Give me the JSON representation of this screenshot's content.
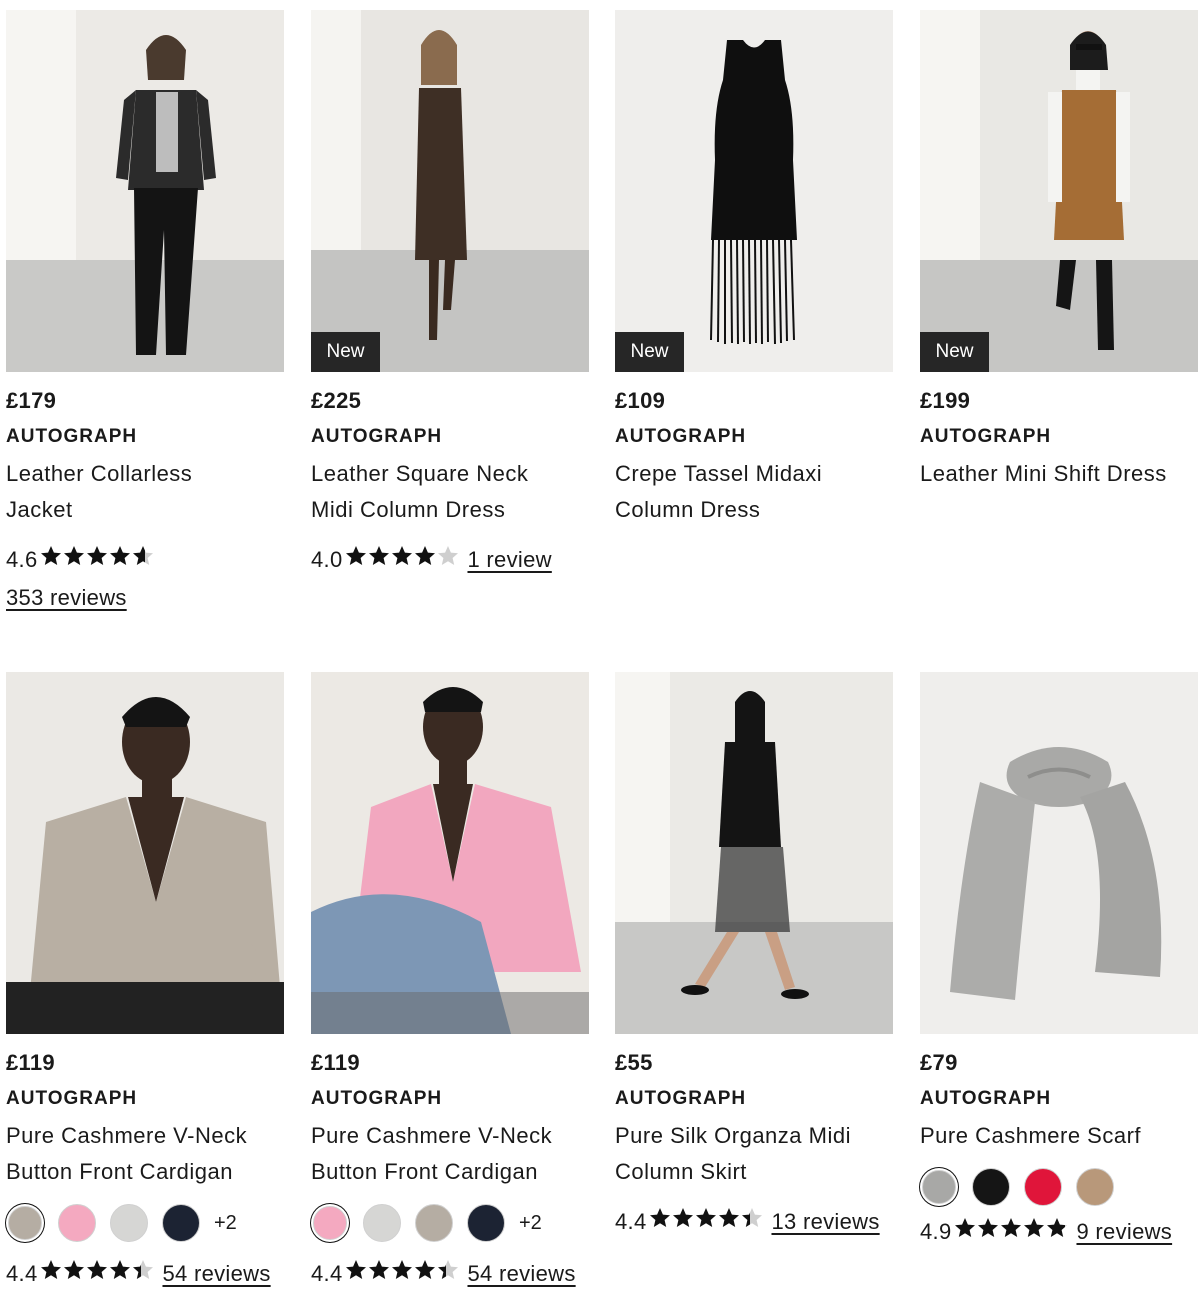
{
  "products": [
    {
      "price": "£179",
      "brand": "AUTOGRAPH",
      "title_line1": "Leather Collarless",
      "title_line2": "Jacket",
      "badge": "",
      "rating": "4.6",
      "stars": 4.6,
      "reviews": "353 reviews",
      "image_icon": "model-leather-jacket-image",
      "swatches": [],
      "more": ""
    },
    {
      "price": "£225",
      "brand": "AUTOGRAPH",
      "title_line1": "Leather Square Neck",
      "title_line2": "Midi Column Dress",
      "badge": "New",
      "rating": "4.0",
      "stars": 4.0,
      "reviews": "1 review",
      "image_icon": "model-leather-dress-image",
      "swatches": [],
      "more": ""
    },
    {
      "price": "£109",
      "brand": "AUTOGRAPH",
      "title_line1": "Crepe Tassel Midaxi",
      "title_line2": "Column Dress",
      "badge": "New",
      "rating": "",
      "stars": 0,
      "reviews": "",
      "image_icon": "tassel-dress-image",
      "swatches": [],
      "more": ""
    },
    {
      "price": "£199",
      "brand": "AUTOGRAPH",
      "title_line1": "Leather Mini Shift Dress",
      "title_line2": "",
      "badge": "New",
      "rating": "",
      "stars": 0,
      "reviews": "",
      "image_icon": "model-shift-dress-image",
      "swatches": [],
      "more": ""
    },
    {
      "price": "£119",
      "brand": "AUTOGRAPH",
      "title_line1": "Pure Cashmere V-Neck",
      "title_line2": "Button Front Cardigan",
      "badge": "",
      "rating": "4.4",
      "stars": 4.4,
      "reviews": "54 reviews",
      "image_icon": "model-oatmeal-cardigan-image",
      "swatches": [
        "#b5ada3",
        "#f4a9c0",
        "#d6d6d4",
        "#1c2333"
      ],
      "more": "+2"
    },
    {
      "price": "£119",
      "brand": "AUTOGRAPH",
      "title_line1": "Pure Cashmere V-Neck",
      "title_line2": "Button Front Cardigan",
      "badge": "",
      "rating": "4.4",
      "stars": 4.4,
      "reviews": "54 reviews",
      "image_icon": "model-pink-cardigan-image",
      "swatches": [
        "#f4a9c0",
        "#d6d6d4",
        "#b5ada3",
        "#1c2333"
      ],
      "more": "+2"
    },
    {
      "price": "£55",
      "brand": "AUTOGRAPH",
      "title_line1": "Pure Silk Organza Midi",
      "title_line2": "Column Skirt",
      "badge": "",
      "rating": "4.4",
      "stars": 4.4,
      "reviews": "13 reviews",
      "image_icon": "model-organza-skirt-image",
      "swatches": [],
      "more": ""
    },
    {
      "price": "£79",
      "brand": "AUTOGRAPH",
      "title_line1": "Pure Cashmere Scarf",
      "title_line2": "",
      "badge": "",
      "rating": "4.9",
      "stars": 4.9,
      "reviews": "9 reviews",
      "image_icon": "grey-scarf-image",
      "swatches": [
        "#a8a8a6",
        "#151515",
        "#e0153a",
        "#b8987a"
      ],
      "more": ""
    }
  ]
}
